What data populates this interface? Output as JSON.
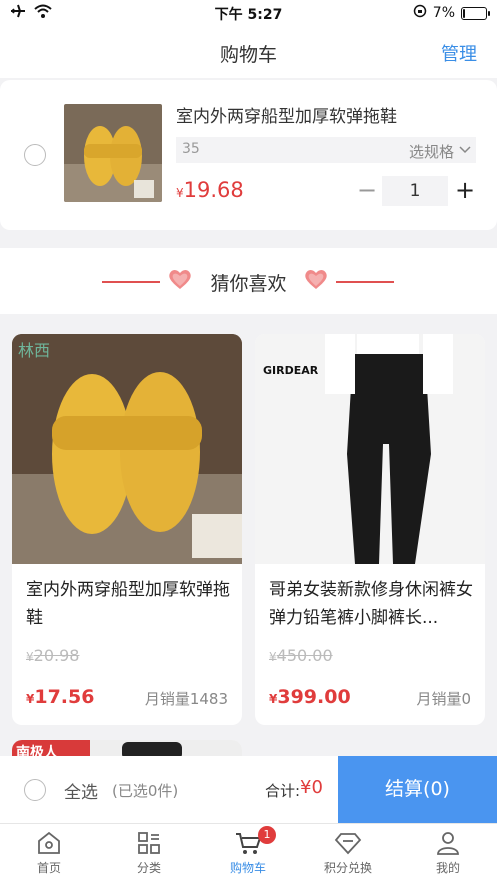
{
  "status_bar": {
    "time": "下午 5:27",
    "battery": "7%",
    "battery_level": 0.07
  },
  "header": {
    "title": "购物车",
    "manage": "管理"
  },
  "cart": {
    "items": [
      {
        "name": "室内外两穿船型加厚软弹拖鞋",
        "spec_value": "35",
        "spec_label": "选规格",
        "currency": "¥",
        "price": "19.68",
        "quantity": "1"
      }
    ]
  },
  "guess": {
    "title": "猜你喜欢"
  },
  "products": [
    {
      "name": "室内外两穿船型加厚软弹拖鞋",
      "currency": "¥",
      "old_price": "20.98",
      "price": "17.56",
      "sold": "月销量1483",
      "image_text": "林西"
    },
    {
      "name": "哥弟女装新款修身休闲裤女弹力铅笔裤小脚裤长...",
      "currency": "¥",
      "old_price": "450.00",
      "price": "399.00",
      "sold": "月销量0",
      "image_text": "GIRDEAR"
    },
    {
      "image_text": "南极人"
    }
  ],
  "checkout": {
    "select_all": "全选",
    "selected_count": "(已选0件)",
    "total_label": "合计:",
    "total_value": "¥0",
    "pay_button": "结算(0)"
  },
  "tabbar": {
    "tabs": [
      {
        "label": "首页",
        "icon": "home-icon"
      },
      {
        "label": "分类",
        "icon": "category-icon"
      },
      {
        "label": "购物车",
        "icon": "cart-icon",
        "badge": "1",
        "active": true
      },
      {
        "label": "积分兑换",
        "icon": "diamond-icon"
      },
      {
        "label": "我的",
        "icon": "profile-icon"
      }
    ]
  },
  "colors": {
    "accent": "#3a8ee6",
    "price": "#e03c3c",
    "pay": "#4a95f0"
  }
}
